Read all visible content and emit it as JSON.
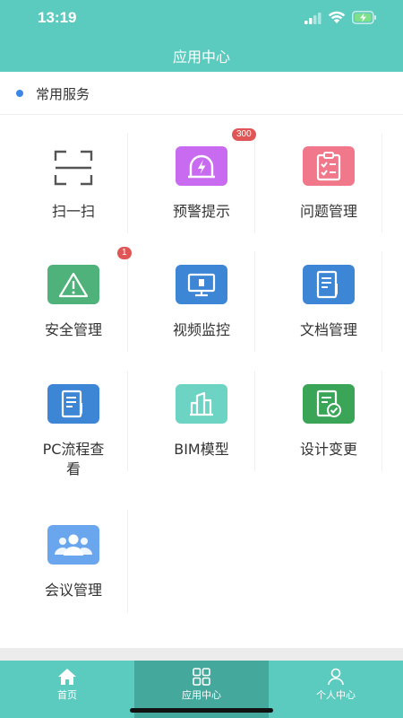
{
  "status_bar": {
    "time": "13:19"
  },
  "nav": {
    "title": "应用中心"
  },
  "section": {
    "title": "常用服务"
  },
  "services": [
    {
      "label": "扫一扫",
      "icon": "scan-icon"
    },
    {
      "label": "预警提示",
      "icon": "alarm-icon",
      "color": "#c86bf0",
      "badge": "300"
    },
    {
      "label": "问题管理",
      "icon": "clipboard-check-icon",
      "color": "#f0788a"
    },
    {
      "label": "安全管理",
      "icon": "warning-icon",
      "color": "#4fb27a",
      "badge": "1"
    },
    {
      "label": "视频监控",
      "icon": "monitor-icon",
      "color": "#3d86d6"
    },
    {
      "label": "文档管理",
      "icon": "document-edit-icon",
      "color": "#3d86d6"
    },
    {
      "label": "PC流程查看",
      "label_lines": [
        "PC流程查",
        "看"
      ],
      "icon": "document-edit-icon",
      "color": "#3d86d6"
    },
    {
      "label": "BIM模型",
      "icon": "building-icon",
      "color": "#6dd3c2"
    },
    {
      "label": "设计变更",
      "icon": "document-check-icon",
      "color": "#3aa557"
    },
    {
      "label": "会议管理",
      "icon": "group-icon",
      "color": "#6aa6ee"
    }
  ],
  "tabs": [
    {
      "label": "首页",
      "icon": "home-icon"
    },
    {
      "label": "应用中心",
      "icon": "grid-icon",
      "active": true
    },
    {
      "label": "个人中心",
      "icon": "person-icon"
    }
  ],
  "colors": {
    "primary": "#5ccbbf",
    "tab_active": "#44a89d",
    "badge": "#e05656",
    "dot": "#3b86e8"
  }
}
